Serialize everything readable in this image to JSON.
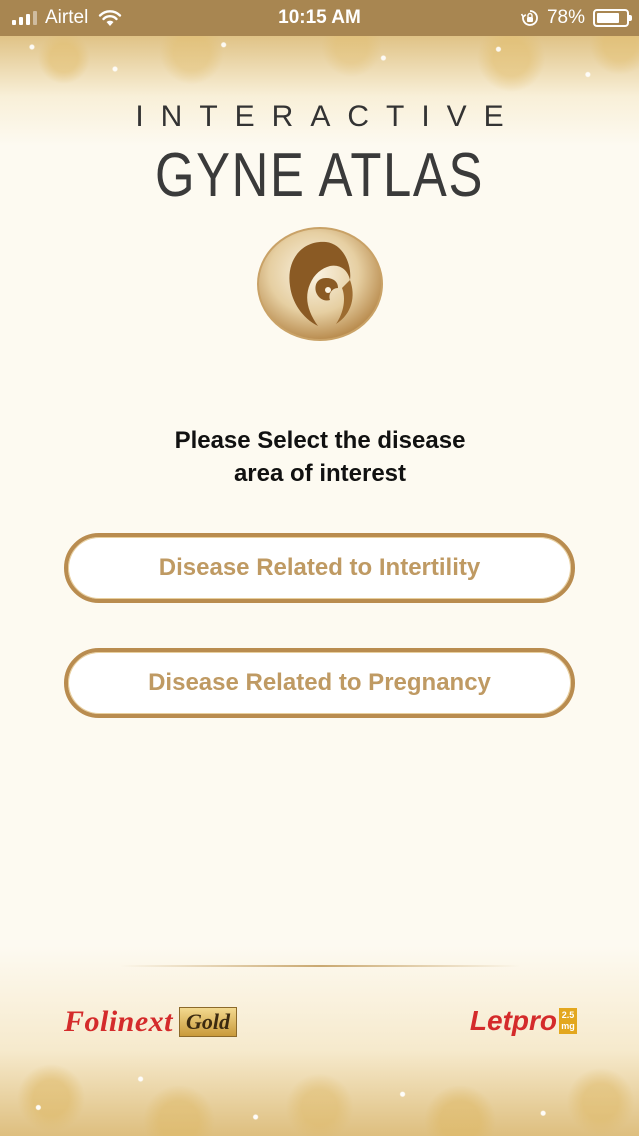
{
  "status_bar": {
    "carrier": "Airtel",
    "time": "10:15 AM",
    "battery": "78%",
    "battery_level": 0.78
  },
  "header": {
    "subtitle": "INTERACTIVE",
    "title": "GYNE ATLAS"
  },
  "prompt": {
    "line1": "Please Select the disease",
    "line2": "area of interest"
  },
  "options": [
    {
      "label": "Disease Related to Intertility"
    },
    {
      "label": "Disease Related to Pregnancy"
    }
  ],
  "footer": {
    "brand_left_name": "Folinext",
    "brand_left_badge": "Gold",
    "brand_right_name": "Letpro",
    "brand_right_dose_value": "2.5",
    "brand_right_dose_unit": "mg"
  },
  "colors": {
    "status_bar": "#a88651",
    "button_border": "#b98c4f",
    "button_text": "#bf9a63",
    "brand_red": "#d42b2b"
  },
  "icons": [
    "signal-icon",
    "wifi-icon",
    "rotation-lock-icon",
    "battery-icon",
    "mother-child-logo"
  ]
}
